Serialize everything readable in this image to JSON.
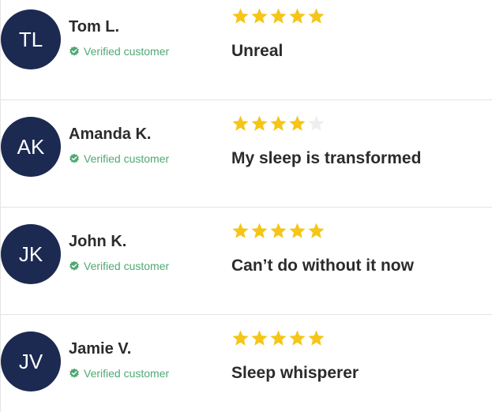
{
  "colors": {
    "avatar_bg": "#1c2a52",
    "star_filled": "#f5c518",
    "star_empty": "#eeeeee",
    "verified": "#4fa874",
    "text": "#2b2b2b"
  },
  "reviews": [
    {
      "initials": "TL",
      "name": "Tom L.",
      "verified_label": "Verified customer",
      "rating": 5,
      "title": "Unreal"
    },
    {
      "initials": "AK",
      "name": "Amanda K.",
      "verified_label": "Verified customer",
      "rating": 4,
      "title": "My sleep is transformed"
    },
    {
      "initials": "JK",
      "name": "John K.",
      "verified_label": "Verified customer",
      "rating": 5,
      "title": "Can’t do without it now"
    },
    {
      "initials": "JV",
      "name": "Jamie V.",
      "verified_label": "Verified customer",
      "rating": 5,
      "title": "Sleep whisperer"
    }
  ]
}
